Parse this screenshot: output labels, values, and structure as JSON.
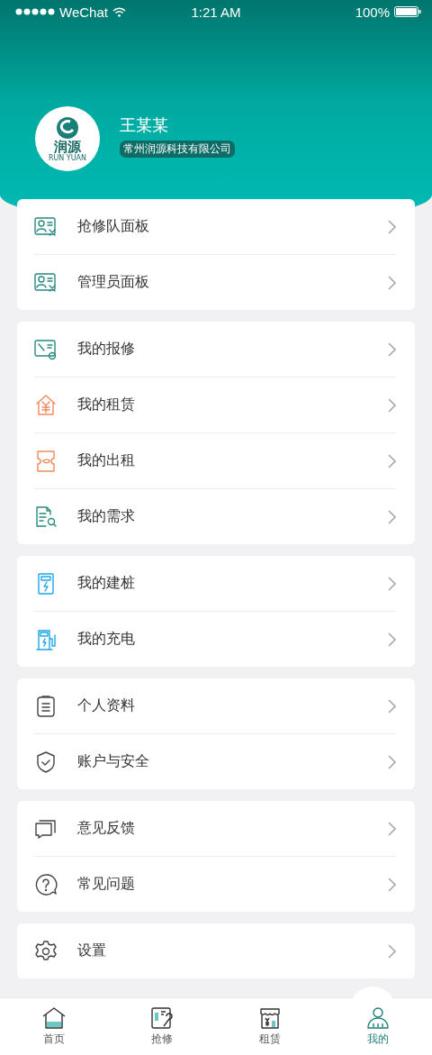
{
  "status_bar": {
    "carrier": "WeChat",
    "time": "1:21 AM",
    "battery": "100%"
  },
  "profile": {
    "logo_text": "润源",
    "logo_subtext": "RUN YUAN",
    "name": "王某某",
    "company": "常州润源科技有限公司"
  },
  "menu_groups": [
    {
      "items": [
        {
          "label": "抢修队面板"
        },
        {
          "label": "管理员面板"
        }
      ]
    },
    {
      "items": [
        {
          "label": "我的报修"
        },
        {
          "label": "我的租赁"
        },
        {
          "label": "我的出租"
        },
        {
          "label": "我的需求"
        }
      ]
    },
    {
      "items": [
        {
          "label": "我的建桩"
        },
        {
          "label": "我的充电"
        }
      ]
    },
    {
      "items": [
        {
          "label": "个人资料"
        },
        {
          "label": "账户与安全"
        }
      ]
    },
    {
      "items": [
        {
          "label": "意见反馈"
        },
        {
          "label": "常见问题"
        }
      ]
    },
    {
      "items": [
        {
          "label": "设置"
        }
      ]
    }
  ],
  "tabs": [
    {
      "label": "首页",
      "selected": false
    },
    {
      "label": "抢修",
      "selected": false
    },
    {
      "label": "租赁",
      "selected": false
    },
    {
      "label": "我的",
      "selected": true
    }
  ]
}
